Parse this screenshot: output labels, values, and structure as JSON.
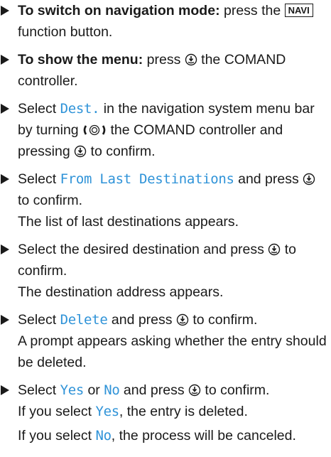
{
  "steps": [
    {
      "t1": "To switch on navigation mode:",
      "t2": " press the",
      "key": "NAVI",
      "t3": " function button."
    },
    {
      "t1": "To show the menu:",
      "t2": " press",
      "t3": " the COMAND controller."
    },
    {
      "t1": "Select ",
      "hl": "Dest.",
      "t2": " in the navigation system menu bar by turning",
      "t3": " the COMAND controller and pressing",
      "t4": " to confirm."
    },
    {
      "t1": "Select ",
      "hl": "From Last Destinations",
      "t2": " and press",
      "t3": " to confirm.",
      "result": "The list of last destinations appears."
    },
    {
      "t1": "Select the desired destination and press",
      "t2": " to confirm.",
      "result": "The destination address appears."
    },
    {
      "t1": "Select ",
      "hl": "Delete",
      "t2": " and press",
      "t3": " to confirm.",
      "result": "A prompt appears asking whether the entry should be deleted."
    },
    {
      "t1": "Select ",
      "hl": "Yes",
      "t2": " or ",
      "hl2": "No",
      "t3": " and press",
      "t4": " to confirm.",
      "r1a": "If you select ",
      "r1hl": "Yes",
      "r1b": ", the entry is deleted.",
      "r2a": "If you select ",
      "r2hl": "No",
      "r2b": ", the process will be canceled."
    }
  ],
  "icons": {
    "press": "controller-press-icon",
    "turn": "controller-turn-icon"
  }
}
